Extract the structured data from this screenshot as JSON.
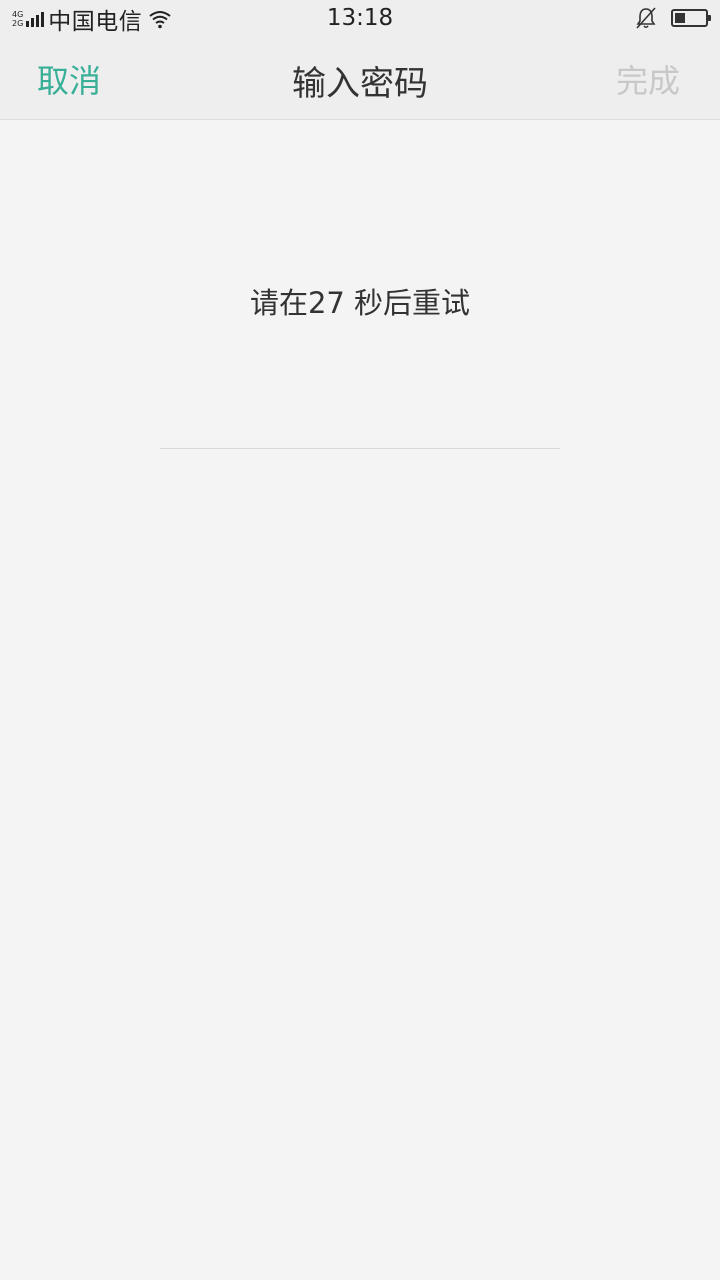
{
  "status_bar": {
    "net_type_top": "4G",
    "net_type_bottom": "2G",
    "carrier": "中国电信",
    "time": "13:18",
    "icons": [
      "signal-icon",
      "wifi-icon",
      "bell-muted-icon",
      "battery-icon"
    ],
    "battery_level": 0.35
  },
  "nav": {
    "cancel_label": "取消",
    "title": "输入密码",
    "done_label": "完成"
  },
  "main": {
    "retry_message": "请在27 秒后重试"
  },
  "colors": {
    "accent": "#3aaf98",
    "disabled": "#c8c8c8",
    "background": "#f4f4f4",
    "bar_background": "#eeeeee"
  }
}
